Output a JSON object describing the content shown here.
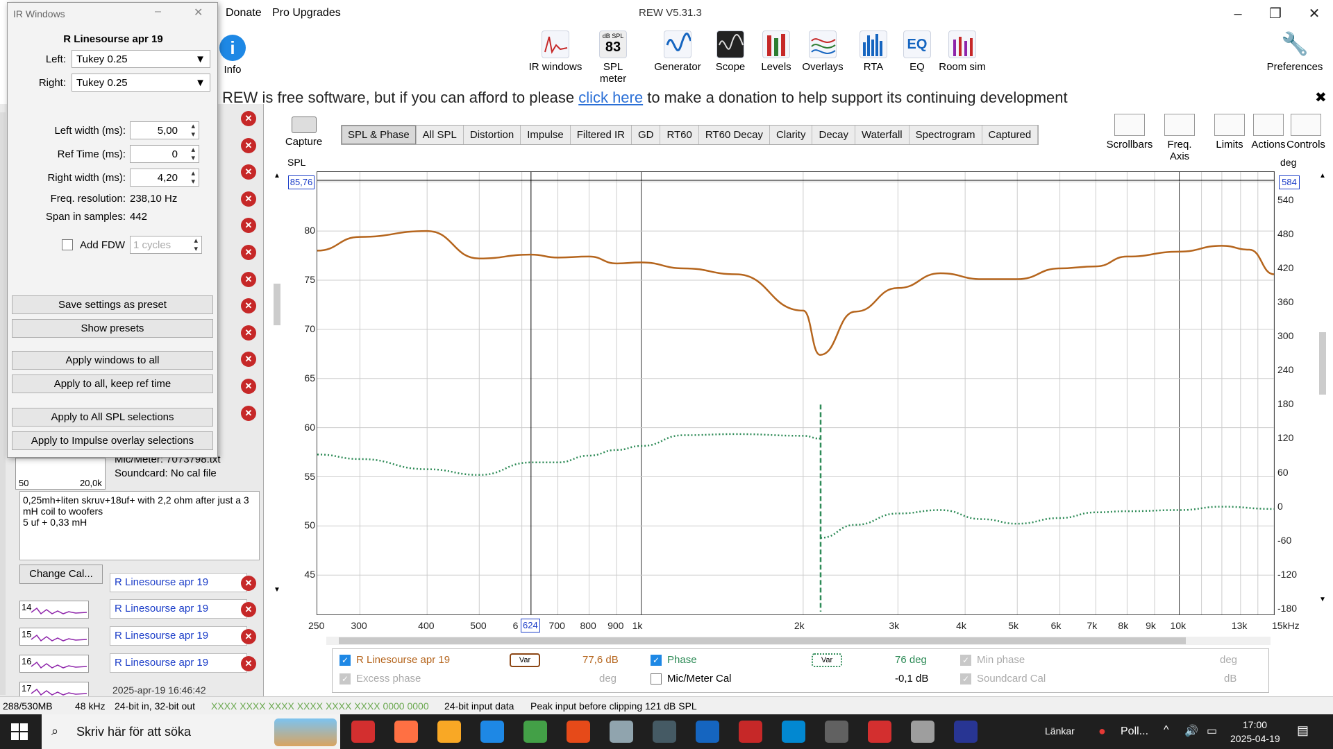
{
  "app": {
    "title": "REW V5.31.3",
    "menu": [
      "Donate",
      "Pro Upgrades"
    ]
  },
  "toolbar": {
    "info": "Info",
    "tools": [
      "IR windows",
      "SPL meter",
      "Generator",
      "Scope",
      "Levels",
      "Overlays",
      "RTA",
      "EQ",
      "Room sim"
    ],
    "spl_small": "dB SPL",
    "spl_value": "83",
    "preferences": "Preferences"
  },
  "donate": {
    "pre": "REW is free software, but if you can afford to please ",
    "link": "click here",
    "post": " to make a donation to help support its continuing development"
  },
  "capture": "Capture",
  "tabs": [
    "SPL & Phase",
    "All SPL",
    "Distortion",
    "Impulse",
    "Filtered IR",
    "GD",
    "RT60",
    "RT60 Decay",
    "Clarity",
    "Decay",
    "Waterfall",
    "Spectrogram",
    "Captured"
  ],
  "righttools": [
    "Scrollbars",
    "Freq. Axis",
    "Limits",
    "Actions",
    "Controls"
  ],
  "plot": {
    "left_unit": "SPL",
    "right_unit": "deg",
    "left_marker": "85,76",
    "right_marker": "584",
    "x_marker": "624",
    "y_left_ticks": [
      "80",
      "75",
      "70",
      "65",
      "60",
      "55",
      "50",
      "45"
    ],
    "y_right_ticks": [
      "540",
      "480",
      "420",
      "360",
      "300",
      "240",
      "180",
      "120",
      "60",
      "0",
      "-60",
      "-120",
      "-180"
    ],
    "x_ticks": [
      "250",
      "300",
      "400",
      "500",
      "6",
      "700",
      "800",
      "900",
      "1k",
      "2k",
      "3k",
      "4k",
      "5k",
      "6k",
      "7k",
      "8k",
      "9k",
      "10k",
      "13k",
      "15kHz"
    ]
  },
  "chart_data": {
    "type": "line",
    "xlabel": "",
    "xlim": [
      250,
      15000
    ],
    "x_scale": "log",
    "ylim_left": [
      41,
      86
    ],
    "ylim_right": [
      -190,
      590
    ],
    "series": [
      {
        "name": "R Linesourse apr 19",
        "axis": "SPL",
        "color": "#b5651d",
        "x": [
          250,
          300,
          400,
          500,
          624,
          700,
          800,
          900,
          1000,
          1200,
          1500,
          2000,
          2150,
          2500,
          3000,
          3600,
          4300,
          5000,
          6000,
          7000,
          8000,
          10000,
          12000,
          13500,
          15000
        ],
        "y": [
          78,
          79.4,
          80,
          77.2,
          77.6,
          77.3,
          77.4,
          76.7,
          76.8,
          76.2,
          75.6,
          71.9,
          67.4,
          71.8,
          74.2,
          75.7,
          75.1,
          75.1,
          76.2,
          76.4,
          77.4,
          77.9,
          78.5,
          78.1,
          75.6
        ]
      },
      {
        "name": "Phase",
        "axis": "deg",
        "color": "#2e8b57",
        "x": [
          250,
          300,
          400,
          500,
          624,
          700,
          800,
          900,
          1000,
          1200,
          1500,
          2000,
          2150,
          2155,
          2500,
          3000,
          3600,
          4300,
          5000,
          6000,
          7000,
          8000,
          10000,
          12000,
          15000
        ],
        "y": [
          92,
          84,
          66,
          56,
          78,
          78,
          90,
          100,
          107,
          126,
          128,
          125,
          120,
          -55,
          -32,
          -12,
          -6,
          -22,
          -30,
          -20,
          -10,
          -8,
          -6,
          0,
          -4
        ]
      }
    ]
  },
  "legend": {
    "meas": "R Linesourse apr 19",
    "var": "Var",
    "meas_val": "77,6 dB",
    "phase": "Phase",
    "phase_val": "76 deg",
    "minphase": "Min phase",
    "minphase_unit": "deg",
    "excess": "Excess phase",
    "excess_unit": "deg",
    "mic": "Mic/Meter Cal",
    "mic_val": "-0,1 dB",
    "soundcard": "Soundcard Cal",
    "soundcard_unit": "dB"
  },
  "leftpanel": {
    "mic": "Mic/Meter: 7073798.txt",
    "soundcard": "Soundcard: No cal file",
    "mini_left": "50",
    "mini_right": "20,0k",
    "notes": "0,25mh+liten skruv+18uf+ with 2,2 ohm after just a 3 mH coil to woofers\n5 uf + 0,33 mH",
    "change_cal": "Change Cal...",
    "rows": [
      {
        "num": "14",
        "name": "R Linesourse apr 19"
      },
      {
        "num": "15",
        "name": "R Linesourse apr 19"
      },
      {
        "num": "16",
        "name": "R Linesourse apr 19"
      },
      {
        "num": "17",
        "name": "2025-apr-19 16:46:42"
      }
    ],
    "first_row_name": "R Linesourse apr 19"
  },
  "irwindow": {
    "title": "IR Windows",
    "meas": "R Linesourse apr 19",
    "left_label": "Left:",
    "left_val": "Tukey 0.25",
    "right_label": "Right:",
    "right_val": "Tukey 0.25",
    "lw_label": "Left width (ms):",
    "lw_val": "5,00",
    "rt_label": "Ref Time (ms):",
    "rt_val": "0",
    "rw_label": "Right width (ms):",
    "rw_val": "4,20",
    "fr_label": "Freq. resolution:",
    "fr_val": "238,10 Hz",
    "span_label": "Span in samples:",
    "span_val": "442",
    "fdw_label": "Add FDW",
    "fdw_val": "1 cycles",
    "buttons": [
      "Save settings as preset",
      "Show presets",
      "Apply windows to all",
      "Apply to all, keep ref time",
      "Apply to All SPL selections",
      "Apply to Impulse overlay selections"
    ]
  },
  "status": {
    "mem": "288/530MB",
    "rate": "48 kHz",
    "bits": "24-bit in, 32-bit out",
    "meters": "XXXX XXXX  XXXX XXXX  XXXX XXXX  0000 0000",
    "input": "24-bit input data",
    "peak": "Peak input before clipping 121 dB SPL"
  },
  "taskbar": {
    "search": "Skriv här för att söka",
    "links": "Länkar",
    "poll": "Poll...",
    "time": "17:00",
    "date": "2025-04-19"
  }
}
